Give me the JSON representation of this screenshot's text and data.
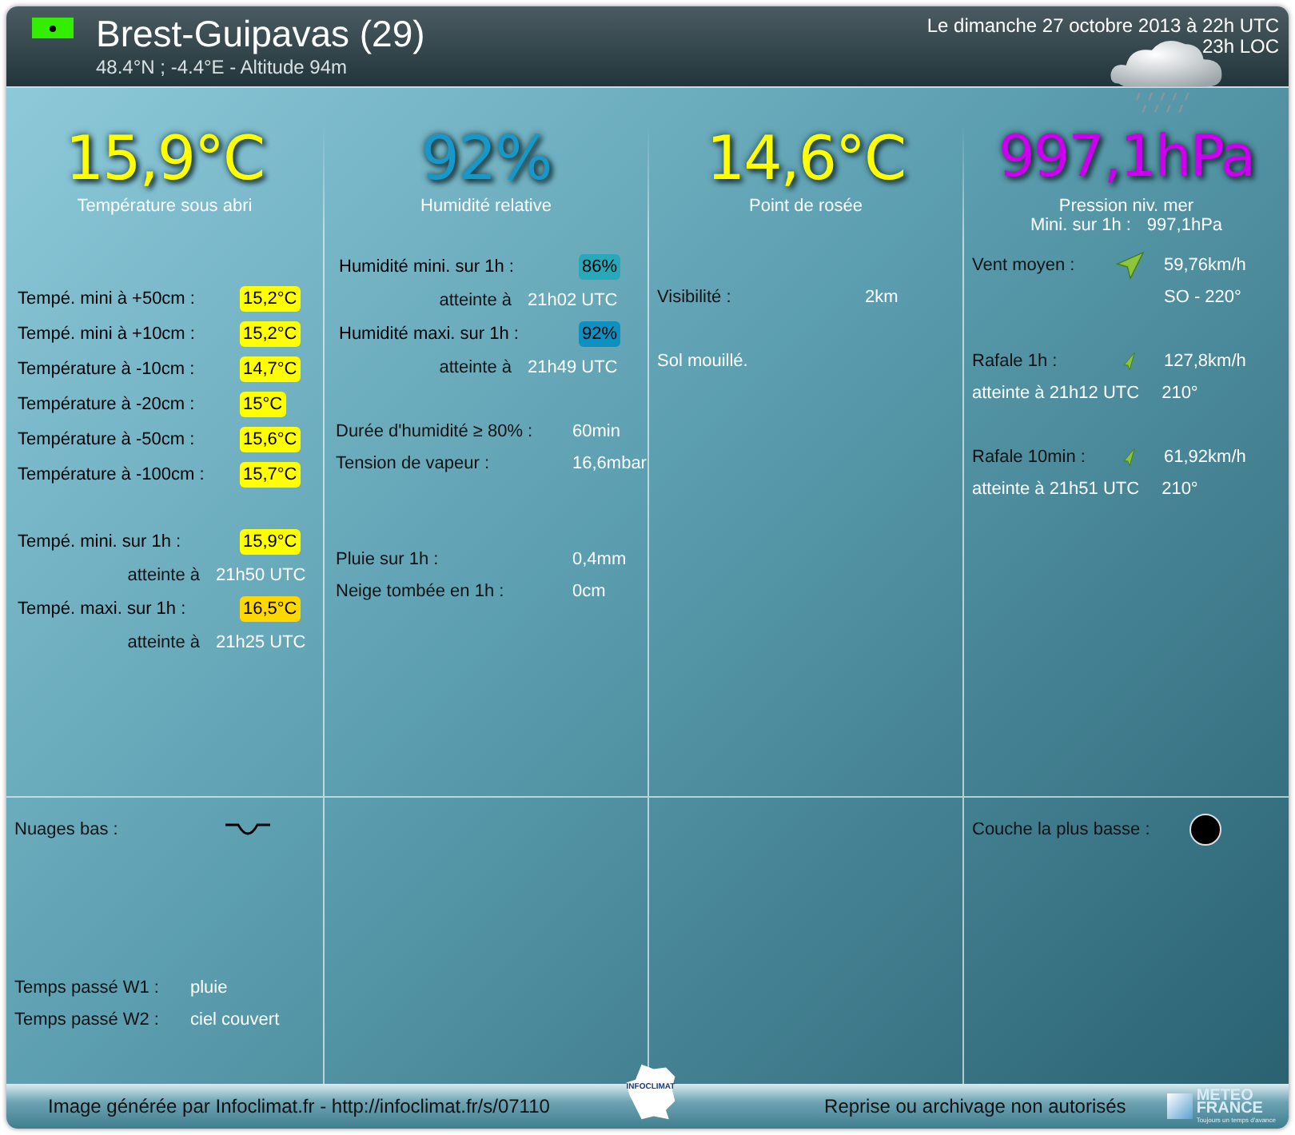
{
  "header": {
    "station": "Brest-Guipavas (29)",
    "coords": "48.4°N ; -4.4°E - Altitude 94m",
    "date": "Le dimanche 27 octobre 2013 à 22h UTC",
    "local": "23h LOC"
  },
  "columns": [
    {
      "hero": {
        "value": "15,9°C",
        "color": "#ffff00",
        "label": "Température sous abri"
      },
      "details": [
        [
          {
            "kind": "badge",
            "label": "Tempé. mini à +50cm :",
            "value": "15,2°C",
            "color": "#ffff00"
          },
          {
            "kind": "badge",
            "label": "Tempé. mini à +10cm :",
            "value": "15,2°C",
            "color": "#ffff00"
          },
          {
            "kind": "badge",
            "label": "Température à -10cm :",
            "value": "14,7°C",
            "color": "#ffff00"
          },
          {
            "kind": "badge",
            "label": "Température à -20cm :",
            "value": "15°C",
            "color": "#ffff00"
          },
          {
            "kind": "badge",
            "label": "Température à -50cm :",
            "value": "15,6°C",
            "color": "#ffff00"
          },
          {
            "kind": "badge",
            "label": "Température à -100cm :",
            "value": "15,7°C",
            "color": "#ffff00"
          }
        ],
        [
          {
            "kind": "badge",
            "label": "Tempé. mini. sur 1h :",
            "value": "15,9°C",
            "color": "#ffff00"
          },
          {
            "kind": "time",
            "label": "atteinte à",
            "value": "21h50 UTC"
          },
          {
            "kind": "badge",
            "label": "Tempé. maxi. sur 1h :",
            "value": "16,5°C",
            "color": "#ffd800"
          },
          {
            "kind": "time",
            "label": "atteinte à",
            "value": "21h25 UTC"
          }
        ]
      ],
      "bottom": [
        [
          {
            "kind": "cloud-low",
            "label": "Nuages bas :"
          }
        ],
        [
          {
            "kind": "pair",
            "label": "Temps passé W1 :",
            "value": "pluie"
          },
          {
            "kind": "pair",
            "label": "Temps passé W2 :",
            "value": "ciel couvert"
          }
        ]
      ]
    },
    {
      "hero": {
        "value": "92%",
        "color": "#1898c8",
        "label": "Humidité relative"
      },
      "details": [
        [
          {
            "kind": "badge",
            "label": "Humidité mini. sur 1h :",
            "value": "86%",
            "color": "#28a8b8"
          },
          {
            "kind": "time",
            "label": "atteinte à",
            "value": "21h02 UTC"
          },
          {
            "kind": "badge",
            "label": "Humidité maxi. sur 1h :",
            "value": "92%",
            "color": "#1090c0"
          },
          {
            "kind": "time",
            "label": "atteinte à",
            "value": "21h49 UTC"
          }
        ],
        [
          {
            "kind": "value",
            "label": "Durée d'humidité ≥ 80% :",
            "value": "60min"
          },
          {
            "kind": "value",
            "label": "Tension de vapeur :",
            "value": "16,6mbar"
          }
        ],
        [
          {
            "kind": "value",
            "label": "Pluie sur 1h :",
            "value": "0,4mm"
          },
          {
            "kind": "value",
            "label": "Neige tombée en 1h :",
            "value": "0cm"
          }
        ]
      ]
    },
    {
      "hero": {
        "value": "14,6°C",
        "color": "#ffff00",
        "label": "Point de rosée"
      },
      "details": [
        [
          {
            "kind": "value",
            "label": "Visibilité :",
            "value": "2km"
          }
        ],
        [
          {
            "kind": "text",
            "label": "Sol mouillé."
          }
        ]
      ]
    },
    {
      "hero": {
        "value": "997,1hPa",
        "color": "#cc00ee",
        "label": "Pression niv. mer",
        "extra_label": "Mini. sur 1h :",
        "extra_value": "997,1hPa"
      },
      "details": [
        [
          {
            "kind": "wind",
            "label": "Vent moyen :",
            "value": "59,76km/h"
          },
          {
            "kind": "sub",
            "value": "SO - 220°"
          }
        ],
        [
          {
            "kind": "gust",
            "label": "Rafale 1h :",
            "value": "127,8km/h"
          },
          {
            "kind": "pair",
            "label": "atteinte à 21h12 UTC",
            "value": "210°"
          }
        ],
        [
          {
            "kind": "gust",
            "label": "Rafale 10min :",
            "value": "61,92km/h"
          },
          {
            "kind": "pair",
            "label": "atteinte à 21h51 UTC",
            "value": "210°"
          }
        ]
      ],
      "bottom": [
        [
          {
            "kind": "cover",
            "label": "Couche la plus basse :"
          }
        ]
      ]
    }
  ],
  "footer": {
    "left": "Image générée par Infoclimat.fr - http://infoclimat.fr/s/07110",
    "right": "Reprise ou archivage non autorisés",
    "center_logo": "INFOCLIMAT",
    "logo": "METEO FRANCE",
    "tagline": "Toujours un temps d'avance"
  }
}
